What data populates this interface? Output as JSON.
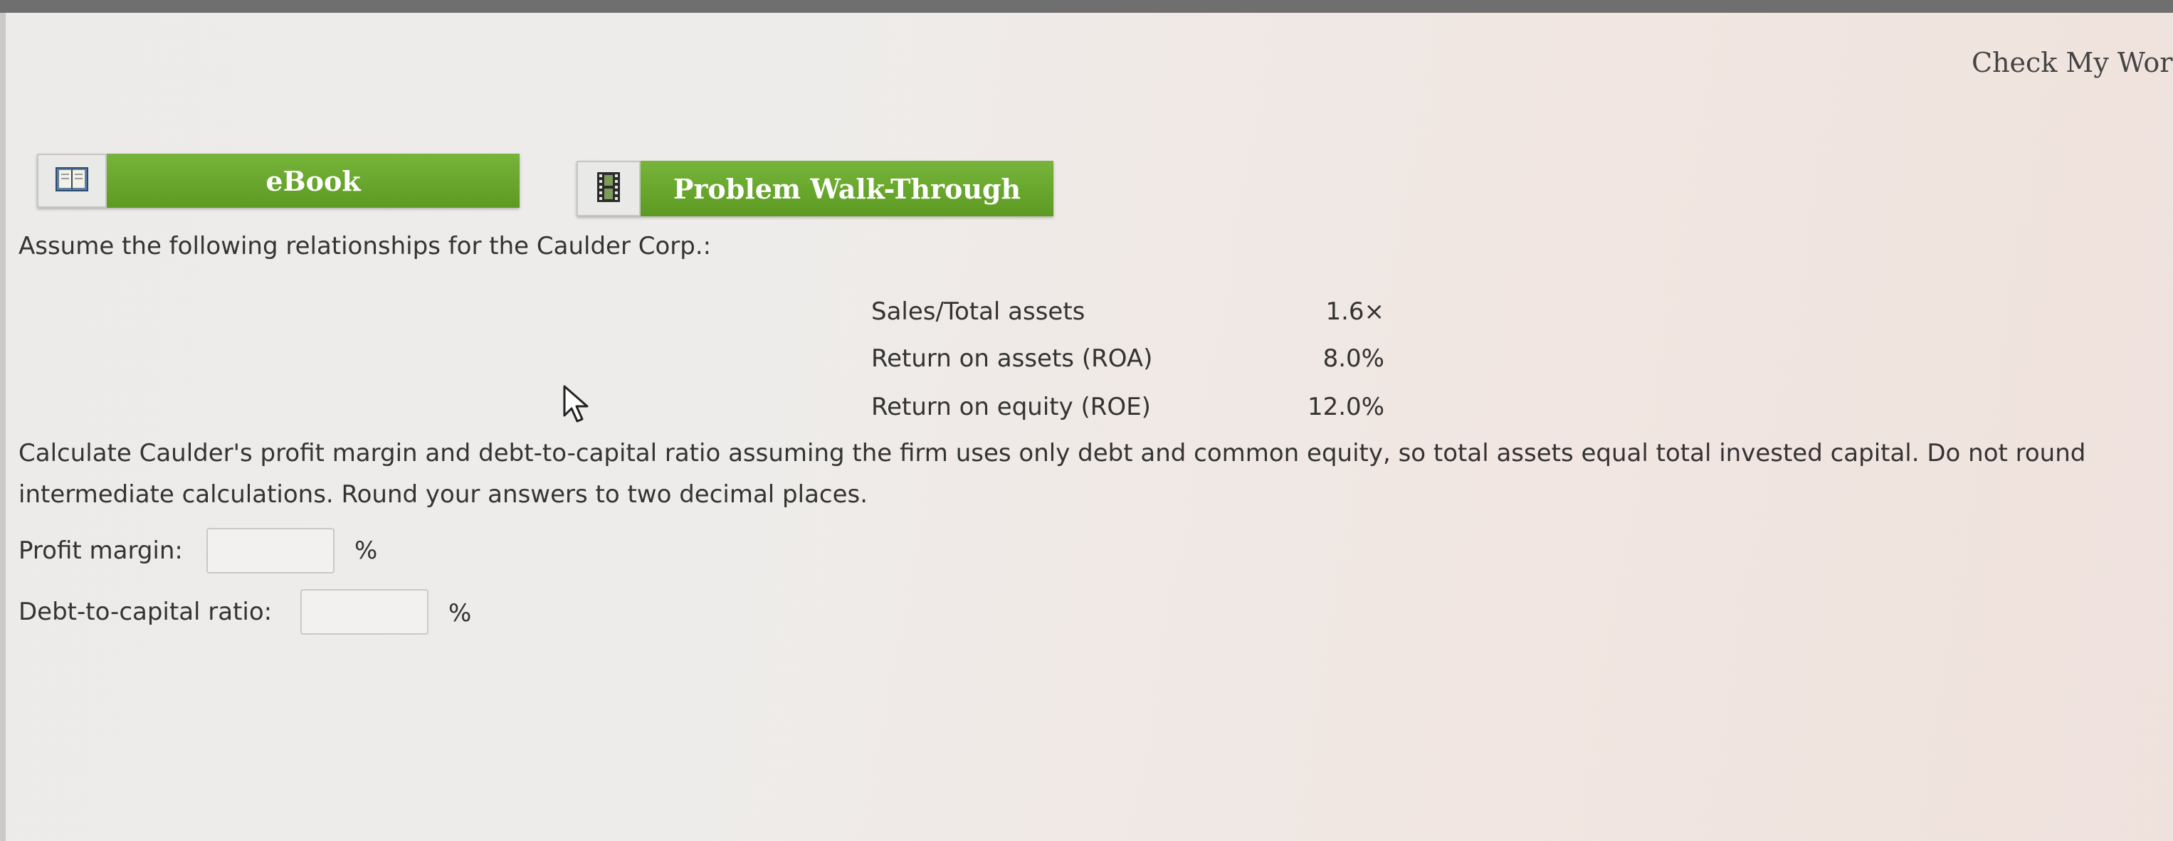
{
  "header": {
    "check_work_label": "Check My Work"
  },
  "toolbar": {
    "ebook": {
      "label": "eBook",
      "icon": "book-icon"
    },
    "walkthrough": {
      "label": "Problem Walk-Through",
      "icon": "film-icon"
    }
  },
  "problem": {
    "intro": "Assume the following relationships for the Caulder Corp.:",
    "ratios": [
      {
        "label": "Sales/Total assets",
        "value": "1.6×"
      },
      {
        "label": "Return on assets (ROA)",
        "value": "8.0%"
      },
      {
        "label": "Return on equity (ROE)",
        "value": "12.0%"
      }
    ],
    "question_line1": "Calculate Caulder's profit margin and debt-to-capital ratio assuming the firm uses only debt and common equity, so total assets equal total invested capital. Do not round",
    "question_line2": "intermediate calculations. Round your answers to two decimal places."
  },
  "answers": {
    "profit_margin": {
      "label": "Profit margin:",
      "value": "",
      "unit": "%"
    },
    "debt_to_capital": {
      "label": "Debt-to-capital ratio:",
      "value": "",
      "unit": "%"
    }
  },
  "colors": {
    "button_green": "#6aa82e",
    "text": "#333333"
  }
}
